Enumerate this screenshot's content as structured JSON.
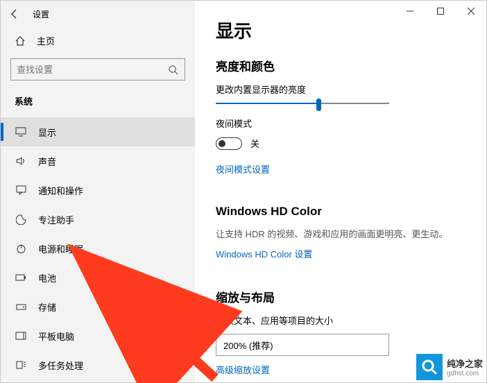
{
  "titlebar": {
    "title": "设置"
  },
  "sidebar": {
    "home": "主页",
    "search_placeholder": "查找设置",
    "group": "系统",
    "items": [
      {
        "label": "显示"
      },
      {
        "label": "声音"
      },
      {
        "label": "通知和操作"
      },
      {
        "label": "专注助手"
      },
      {
        "label": "电源和睡眠"
      },
      {
        "label": "电池"
      },
      {
        "label": "存储"
      },
      {
        "label": "平板电脑"
      },
      {
        "label": "多任务处理"
      }
    ]
  },
  "main": {
    "heading": "显示",
    "brightness": {
      "section": "亮度和颜色",
      "label": "更改内置显示器的亮度",
      "night_mode_label": "夜间模式",
      "toggle_state": "关",
      "night_link": "夜间模式设置"
    },
    "hdr": {
      "section": "Windows HD Color",
      "desc": "让支持 HDR 的视频、游戏和应用的画面更明亮、更生动。",
      "link": "Windows HD Color 设置"
    },
    "scale": {
      "section": "缩放与布局",
      "label": "更改文本、应用等项目的大小",
      "value": "200% (推荐)",
      "link": "高级缩放设置"
    }
  },
  "watermark": {
    "text": "纯净之家",
    "url": "gdhst.com"
  }
}
